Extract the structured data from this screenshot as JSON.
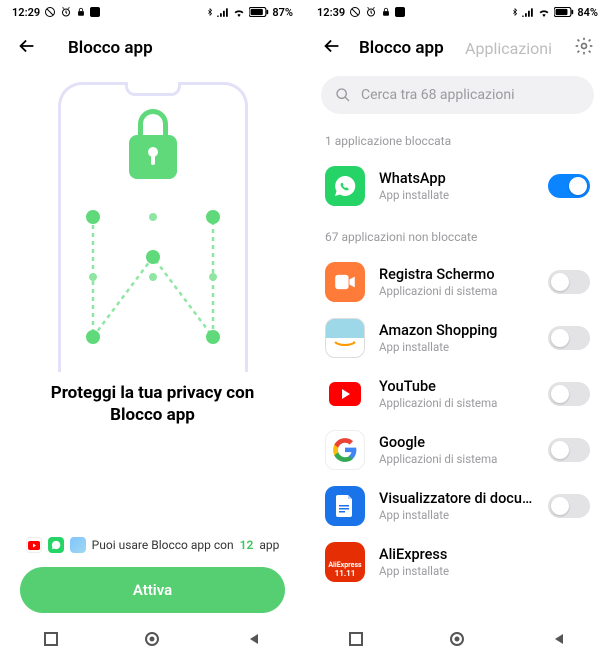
{
  "left": {
    "status": {
      "time": "12:29",
      "battery": "87%"
    },
    "title": "Blocco app",
    "headline": "Proteggi la tua privacy con Blocco app",
    "hint_prefix": "Puoi usare Blocco app con",
    "hint_count": "12",
    "hint_suffix": "app",
    "activate": "Attiva"
  },
  "right": {
    "status": {
      "time": "12:39",
      "battery": "84%"
    },
    "title": "Blocco app",
    "tab": "Applicazioni",
    "search_placeholder": "Cerca tra 68 applicazioni",
    "locked_label": "1 applicazione bloccata",
    "unlocked_label": "67 applicazioni non bloccate",
    "sub_installed": "App installate",
    "sub_system": "Applicazioni di sistema",
    "apps": {
      "whatsapp": "WhatsApp",
      "rec": "Registra Schermo",
      "amazon": "Amazon Shopping",
      "youtube": "YouTube",
      "google": "Google",
      "doc": "Visualizzatore di documen...",
      "ali": "AliExpress"
    }
  }
}
